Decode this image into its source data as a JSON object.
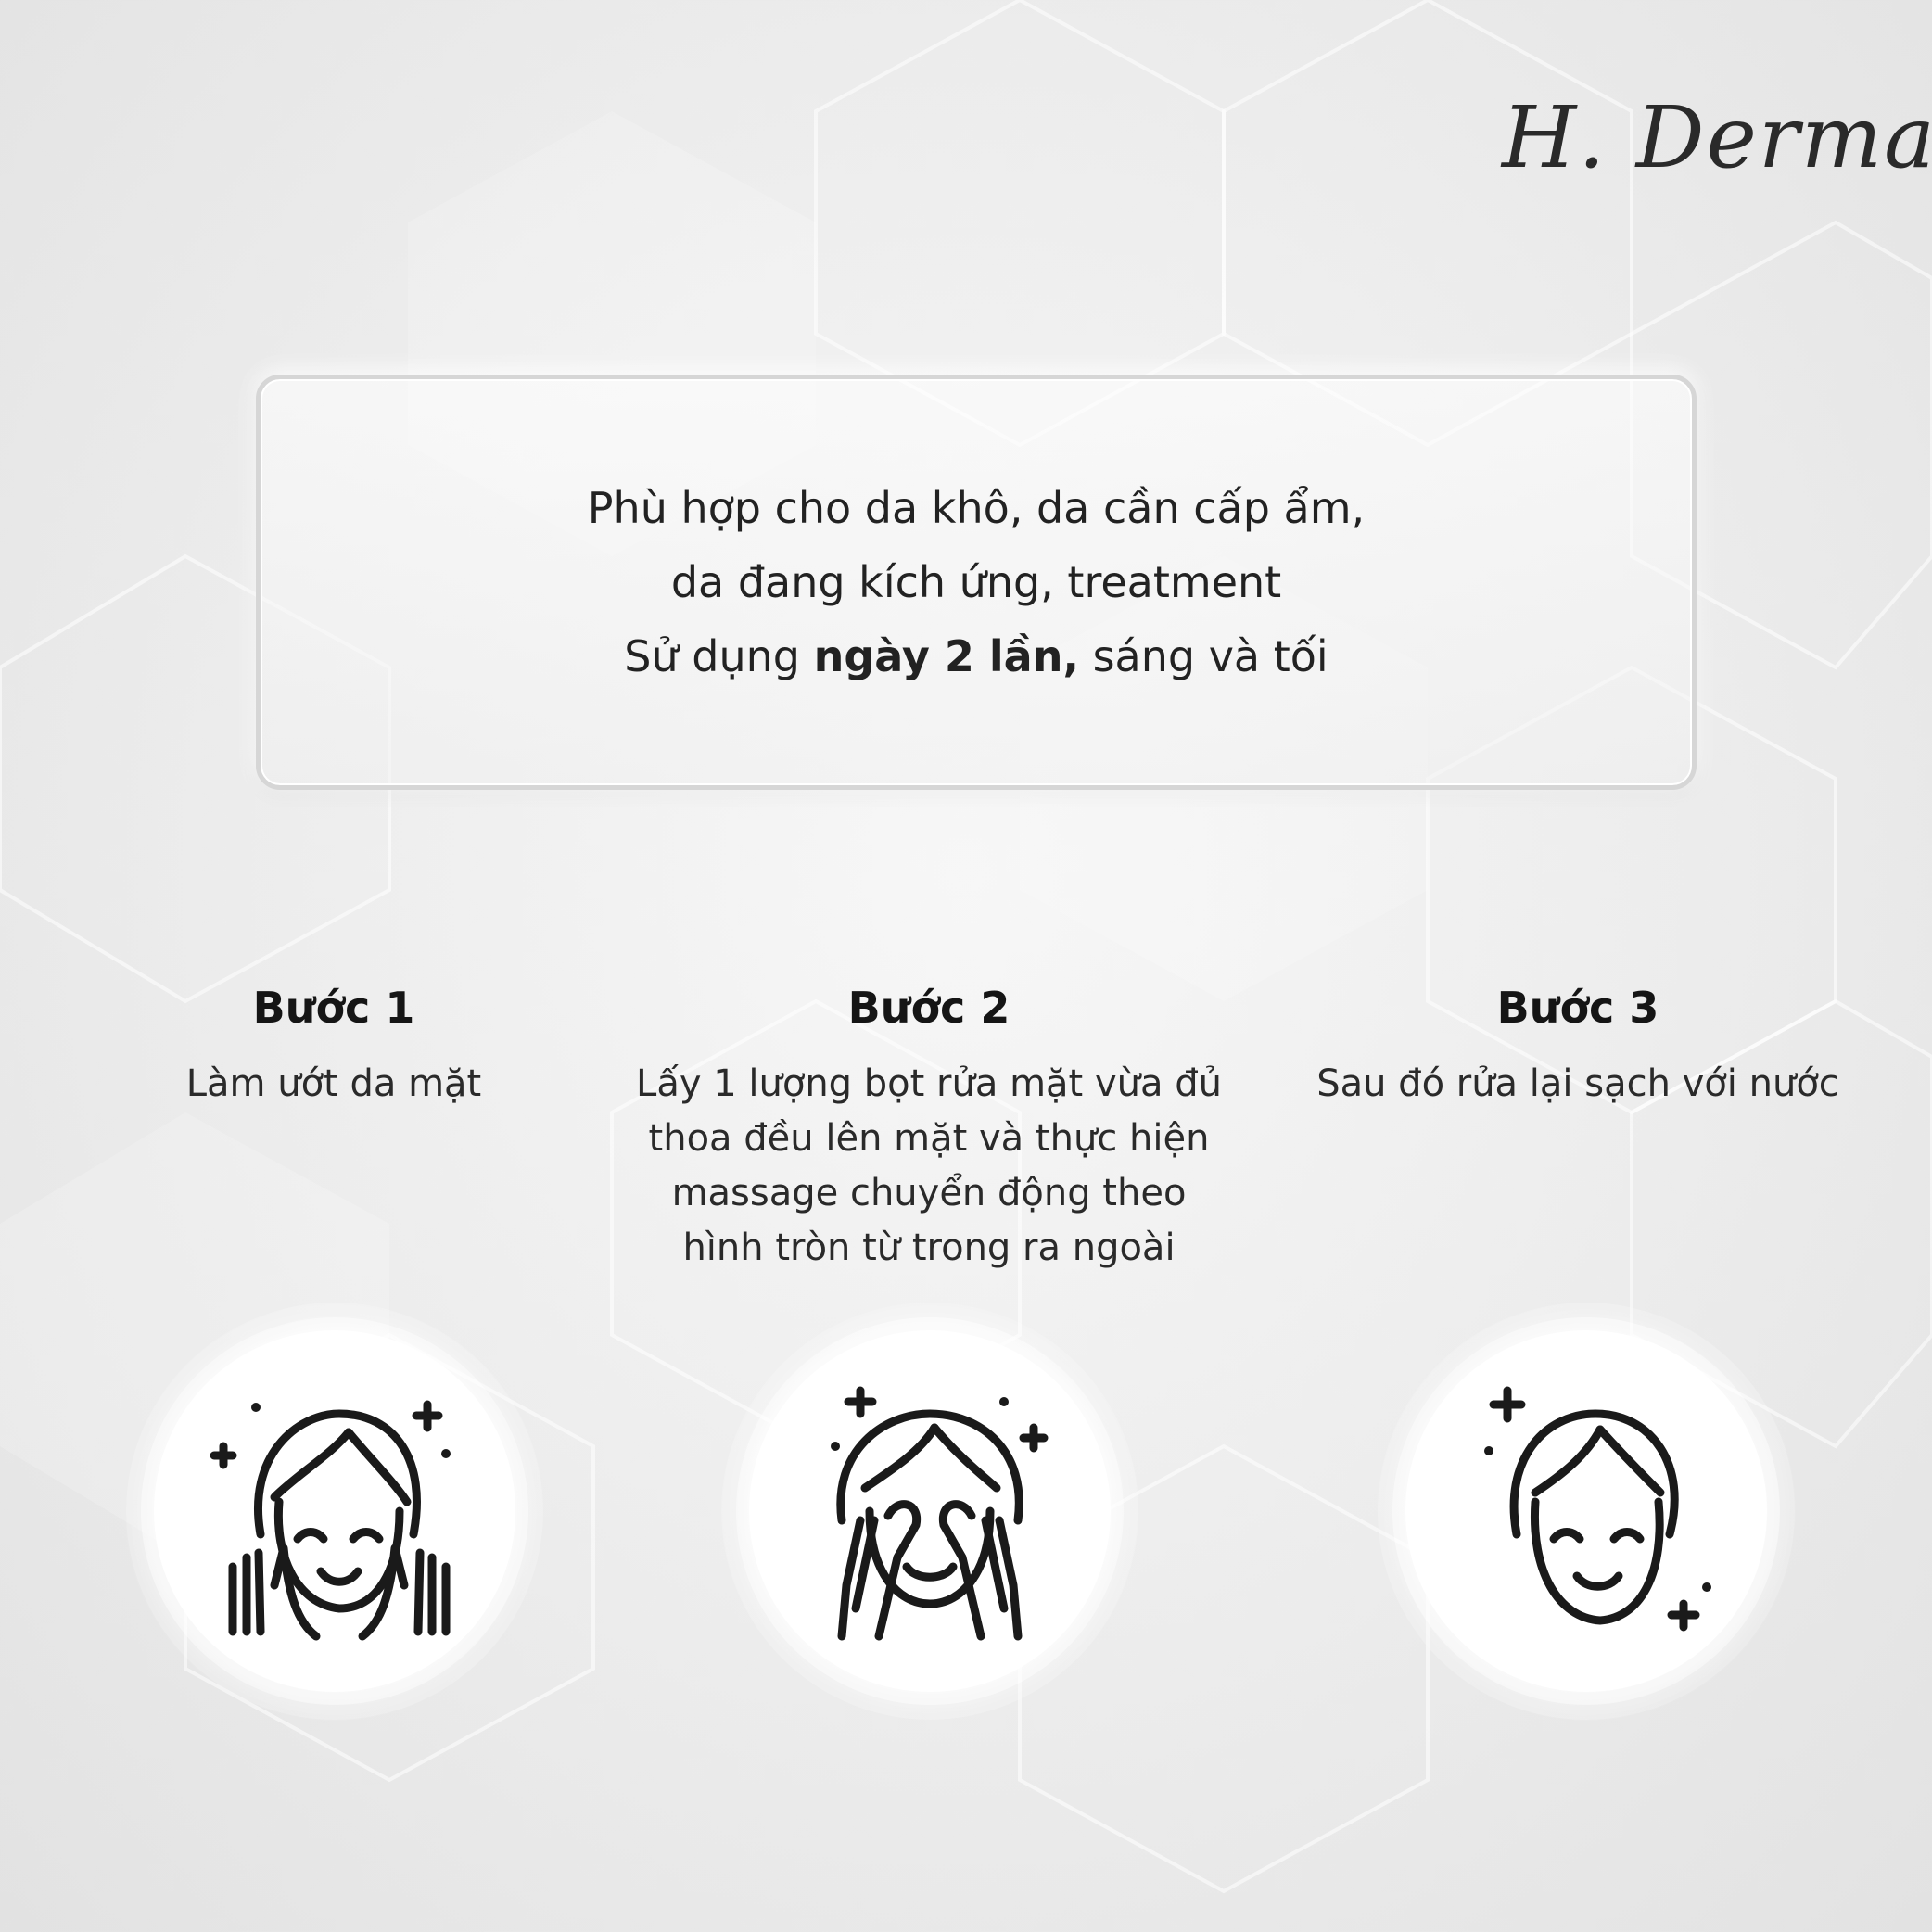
{
  "brand": {
    "logo_text": "H. Derma"
  },
  "info": {
    "line1": "Phù hợp cho da khô, da cần cấp ẩm,",
    "line2": "da đang kích ứng, treatment",
    "line3_pre": "Sử dụng ",
    "line3_bold": "ngày 2 lần,",
    "line3_post": " sáng và tối"
  },
  "steps": [
    {
      "title": "Bước 1",
      "desc_lines": [
        "Làm ướt da mặt"
      ],
      "icon": "face-hands-cheeks-icon"
    },
    {
      "title": "Bước 2",
      "desc_lines": [
        "Lấy 1 lượng bọt rửa mặt vừa đủ",
        "thoa đều lên mặt và thực hiện",
        "massage chuyển động theo",
        "hình tròn từ trong ra ngoài"
      ],
      "icon": "face-massage-icon"
    },
    {
      "title": "Bước 3",
      "desc_lines": [
        "Sau đó rửa lại sạch với nước"
      ],
      "icon": "clean-face-icon"
    }
  ],
  "colors": {
    "background": "#ececec",
    "text": "#1a1a1a",
    "icon_stroke": "#1a1a1a",
    "circle": "#ffffff"
  }
}
